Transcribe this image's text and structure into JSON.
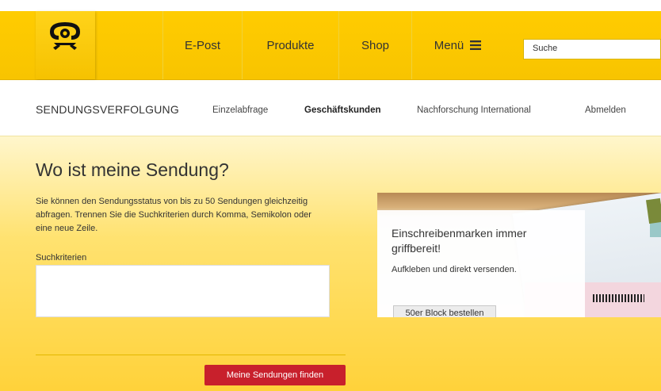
{
  "header": {
    "nav": [
      "E-Post",
      "Produkte",
      "Shop",
      "Menü"
    ],
    "search_placeholder": "Suche"
  },
  "subnav": {
    "title": "SENDUNGSVERFOLGUNG",
    "links": [
      "Einzelabfrage",
      "Geschäftskunden",
      "Nachforschung International",
      "Abmelden"
    ]
  },
  "main": {
    "heading": "Wo ist meine Sendung?",
    "description": "Sie können den Sendungsstatus von bis zu 50 Sendungen gleichzeitig abfragen. Trennen Sie die Suchkriterien durch Komma, Semikolon oder eine neue Zeile.",
    "search_label": "Suchkriterien",
    "textarea_value": "",
    "submit_label": "Meine Sendungen finden"
  },
  "promo": {
    "title": "Einschreibenmarken immer griffbereit!",
    "subtitle": "Aufkleben und direkt versenden.",
    "button_label": "50er Block bestellen"
  },
  "colors": {
    "brand_yellow": "#ffcc00",
    "button_red": "#c8202c"
  }
}
